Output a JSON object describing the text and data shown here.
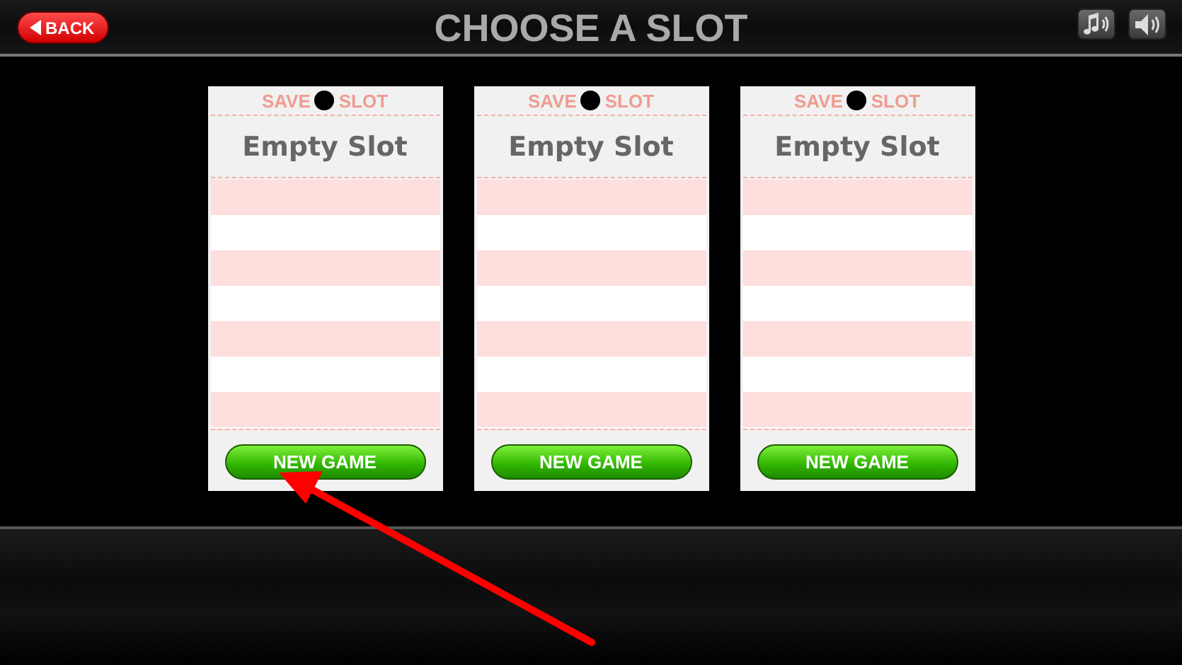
{
  "header": {
    "back_button": "BACK",
    "title": "CHOOSE A SLOT"
  },
  "slots": [
    {
      "label_left": "SAVE",
      "label_right": "SLOT",
      "title": "Empty Slot",
      "button": "NEW GAME"
    },
    {
      "label_left": "SAVE",
      "label_right": "SLOT",
      "title": "Empty Slot",
      "button": "NEW GAME"
    },
    {
      "label_left": "SAVE",
      "label_right": "SLOT",
      "title": "Empty Slot",
      "button": "NEW GAME"
    }
  ]
}
